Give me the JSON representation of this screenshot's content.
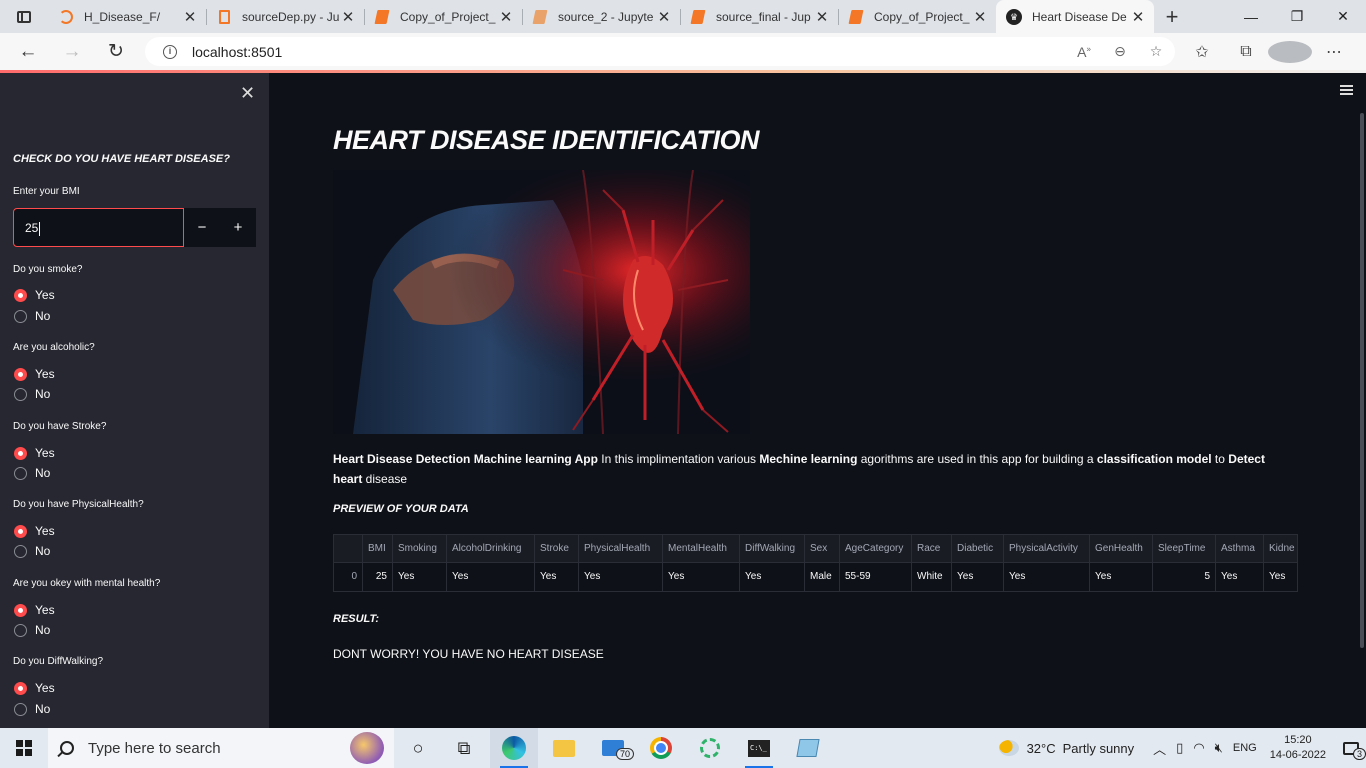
{
  "browser": {
    "tabs": [
      {
        "title": "H_Disease_F/",
        "icon": "jupyter-icon"
      },
      {
        "title": "sourceDep.py - Ju",
        "icon": "file-icon"
      },
      {
        "title": "Copy_of_Project_",
        "icon": "colab-icon"
      },
      {
        "title": "source_2 - Jupyte",
        "icon": "notebook-icon"
      },
      {
        "title": "source_final - Jup",
        "icon": "notebook-icon"
      },
      {
        "title": "Copy_of_Project_",
        "icon": "colab-icon"
      },
      {
        "title": "Heart Disease De",
        "icon": "streamlit-icon"
      }
    ],
    "active_tab": 6,
    "url": "localhost:8501",
    "window_controls": {
      "minimize": "—",
      "maximize": "❐",
      "close": "✕"
    }
  },
  "sidebar": {
    "close_symbol": "✕",
    "title": "CHECK DO YOU HAVE HEART DISEASE?",
    "bmi": {
      "label": "Enter your BMI",
      "value": "25",
      "minus": "−",
      "plus": "+"
    },
    "questions": [
      {
        "label": "Do you smoke?",
        "options": [
          "Yes",
          "No"
        ],
        "selected": "Yes"
      },
      {
        "label": "Are you alcoholic?",
        "options": [
          "Yes",
          "No"
        ],
        "selected": "Yes"
      },
      {
        "label": "Do you have Stroke?",
        "options": [
          "Yes",
          "No"
        ],
        "selected": "Yes"
      },
      {
        "label": "Do you have PhysicalHealth?",
        "options": [
          "Yes",
          "No"
        ],
        "selected": "Yes"
      },
      {
        "label": "Are you okey with mental health?",
        "options": [
          "Yes",
          "No"
        ],
        "selected": "Yes"
      },
      {
        "label": "Do you DiffWalking?",
        "options": [
          "Yes",
          "No"
        ],
        "selected": "Yes"
      }
    ]
  },
  "main": {
    "title": "HEART DISEASE IDENTIFICATION",
    "description": {
      "part1": "Heart Disease Detection Machine learning App",
      "part2": " In this implimentation various ",
      "part3": "Mechine learning",
      "part4": " agorithms are used in this app for building a ",
      "part5": "classification model",
      "part6": " to ",
      "part7": "Detect heart",
      "part8": " disease"
    },
    "preview_heading": "PREVIEW OF YOUR DATA",
    "table": {
      "columns": [
        "",
        "BMI",
        "Smoking",
        "AlcoholDrinking",
        "Stroke",
        "PhysicalHealth",
        "MentalHealth",
        "DiffWalking",
        "Sex",
        "AgeCategory",
        "Race",
        "Diabetic",
        "PhysicalActivity",
        "GenHealth",
        "SleepTime",
        "Asthma",
        "Kidne"
      ],
      "rows": [
        [
          "0",
          "25",
          "Yes",
          "Yes",
          "Yes",
          "Yes",
          "Yes",
          "Yes",
          "Male",
          "55-59",
          "White",
          "Yes",
          "Yes",
          "Yes",
          "5",
          "Yes",
          "Yes"
        ]
      ]
    },
    "result_heading": "RESULT:",
    "result_text": "DONT WORRY! YOU HAVE NO HEART DISEASE"
  },
  "taskbar": {
    "search_placeholder": "Type here to search",
    "mail_badge": "70",
    "weather": {
      "temp": "32°C",
      "condition": "Partly sunny"
    },
    "language": "ENG",
    "time": "15:20",
    "date": "14-06-2022",
    "notification_count": "3"
  }
}
